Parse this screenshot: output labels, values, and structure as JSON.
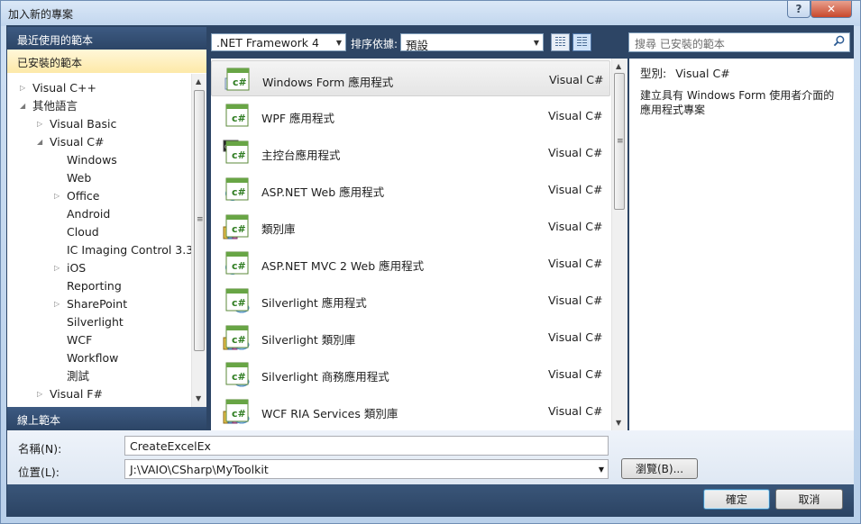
{
  "window": {
    "title": "加入新的專案",
    "help_label": "?",
    "close_label": "✕"
  },
  "sections": {
    "recent": "最近使用的範本",
    "installed": "已安裝的範本",
    "online": "線上範本"
  },
  "tree": [
    {
      "label": "Visual C++",
      "arrow": "▷",
      "level": 0
    },
    {
      "label": "其他語言",
      "arrow": "◢",
      "level": 0
    },
    {
      "label": "Visual Basic",
      "arrow": "▷",
      "level": 1
    },
    {
      "label": "Visual C#",
      "arrow": "◢",
      "level": 1
    },
    {
      "label": "Windows",
      "arrow": "",
      "level": 2
    },
    {
      "label": "Web",
      "arrow": "",
      "level": 2
    },
    {
      "label": "Office",
      "arrow": "▷",
      "level": 2
    },
    {
      "label": "Android",
      "arrow": "",
      "level": 2
    },
    {
      "label": "Cloud",
      "arrow": "",
      "level": 2
    },
    {
      "label": "IC Imaging Control 3.3",
      "arrow": "",
      "level": 2
    },
    {
      "label": "iOS",
      "arrow": "▷",
      "level": 2
    },
    {
      "label": "Reporting",
      "arrow": "",
      "level": 2
    },
    {
      "label": "SharePoint",
      "arrow": "▷",
      "level": 2
    },
    {
      "label": "Silverlight",
      "arrow": "",
      "level": 2
    },
    {
      "label": "WCF",
      "arrow": "",
      "level": 2
    },
    {
      "label": "Workflow",
      "arrow": "",
      "level": 2
    },
    {
      "label": "測試",
      "arrow": "",
      "level": 2
    },
    {
      "label": "Visual F#",
      "arrow": "▷",
      "level": 1
    }
  ],
  "toolbar": {
    "framework": ".NET Framework 4",
    "sort_label": "排序依據:",
    "sort_value": "預設",
    "search_placeholder": "搜尋 已安裝的範本"
  },
  "templates": [
    {
      "name": "Windows Form 應用程式",
      "lang": "Visual C#",
      "icon": "winform-icon"
    },
    {
      "name": "WPF 應用程式",
      "lang": "Visual C#",
      "icon": "wpf-icon"
    },
    {
      "name": "主控台應用程式",
      "lang": "Visual C#",
      "icon": "console-icon"
    },
    {
      "name": "ASP.NET Web 應用程式",
      "lang": "Visual C#",
      "icon": "aspnet-icon"
    },
    {
      "name": "類別庫",
      "lang": "Visual C#",
      "icon": "classlib-icon"
    },
    {
      "name": "ASP.NET MVC 2 Web 應用程式",
      "lang": "Visual C#",
      "icon": "mvc-icon"
    },
    {
      "name": "Silverlight 應用程式",
      "lang": "Visual C#",
      "icon": "silverlight-icon"
    },
    {
      "name": "Silverlight 類別庫",
      "lang": "Visual C#",
      "icon": "silverlight-lib-icon"
    },
    {
      "name": "Silverlight 商務應用程式",
      "lang": "Visual C#",
      "icon": "silverlight-business-icon"
    },
    {
      "name": "WCF RIA Services 類別庫",
      "lang": "Visual C#",
      "icon": "wcf-ria-icon"
    }
  ],
  "description": {
    "type_label": "型別:",
    "type_value": "Visual C#",
    "text": "建立具有 Windows Form 使用者介面的應用程式專案"
  },
  "form": {
    "name_label": "名稱(N):",
    "name_value": "CreateExcelEx",
    "location_label": "位置(L):",
    "location_value": "J:\\VAIO\\CSharp\\MyToolkit",
    "browse_label": "瀏覽(B)...",
    "ok_label": "確定",
    "cancel_label": "取消"
  }
}
